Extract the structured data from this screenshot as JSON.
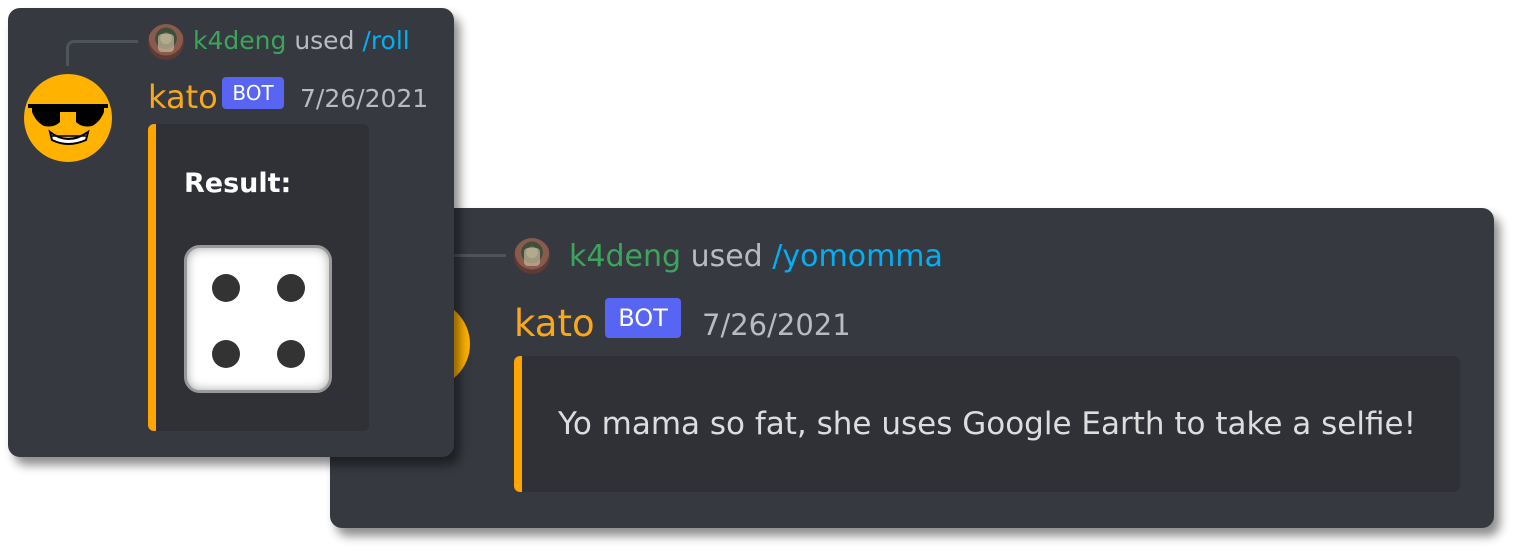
{
  "messages": [
    {
      "reply": {
        "user": "k4deng",
        "used": "used",
        "command": "/roll"
      },
      "author": {
        "name": "kato",
        "tag": "BOT"
      },
      "timestamp": "7/26/2021",
      "embed": {
        "title": "Result:",
        "die_value": 4,
        "accent_color": "#ffa500"
      }
    },
    {
      "reply": {
        "user": "k4deng",
        "used": "used",
        "command": "/yomomma"
      },
      "author": {
        "name": "kato",
        "tag": "BOT"
      },
      "timestamp": "7/26/2021",
      "embed": {
        "description": "Yo mama so fat, she uses Google Earth to take a selfie!",
        "accent_color": "#ffa500"
      }
    }
  ],
  "colors": {
    "background": "#36393f",
    "embed_background": "#2f3136",
    "username": "#faa81a",
    "reply_user": "#3ba55c",
    "command": "#00aff4",
    "bot_tag": "#5865f2"
  },
  "icons": {
    "bot_avatar": "sunglasses-smiley-icon",
    "user_avatar": "user-photo-avatar"
  }
}
